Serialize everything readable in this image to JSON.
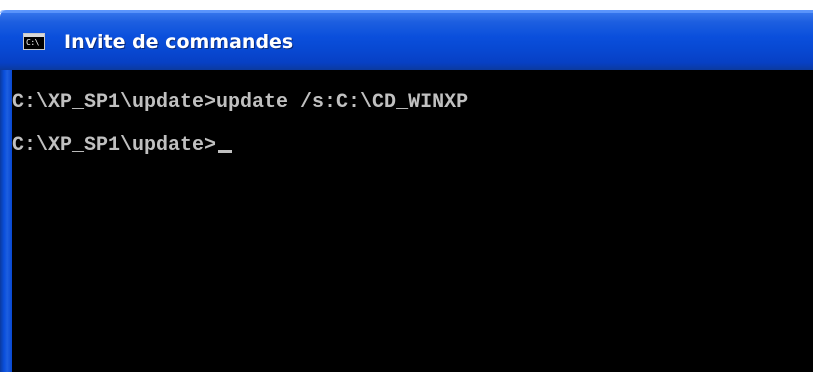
{
  "window": {
    "title": "Invite de commandes",
    "icon_text": "C:\\",
    "icon": "console-icon"
  },
  "console": {
    "lines": [
      "C:\\XP_SP1\\update>update /s:C:\\CD_WINXP",
      "C:\\XP_SP1\\update>"
    ],
    "colors": {
      "background": "#000000",
      "text": "#c0c0c0"
    }
  },
  "theme": {
    "titlebar": "#0a4fdc",
    "title_text": "#ffffff"
  }
}
